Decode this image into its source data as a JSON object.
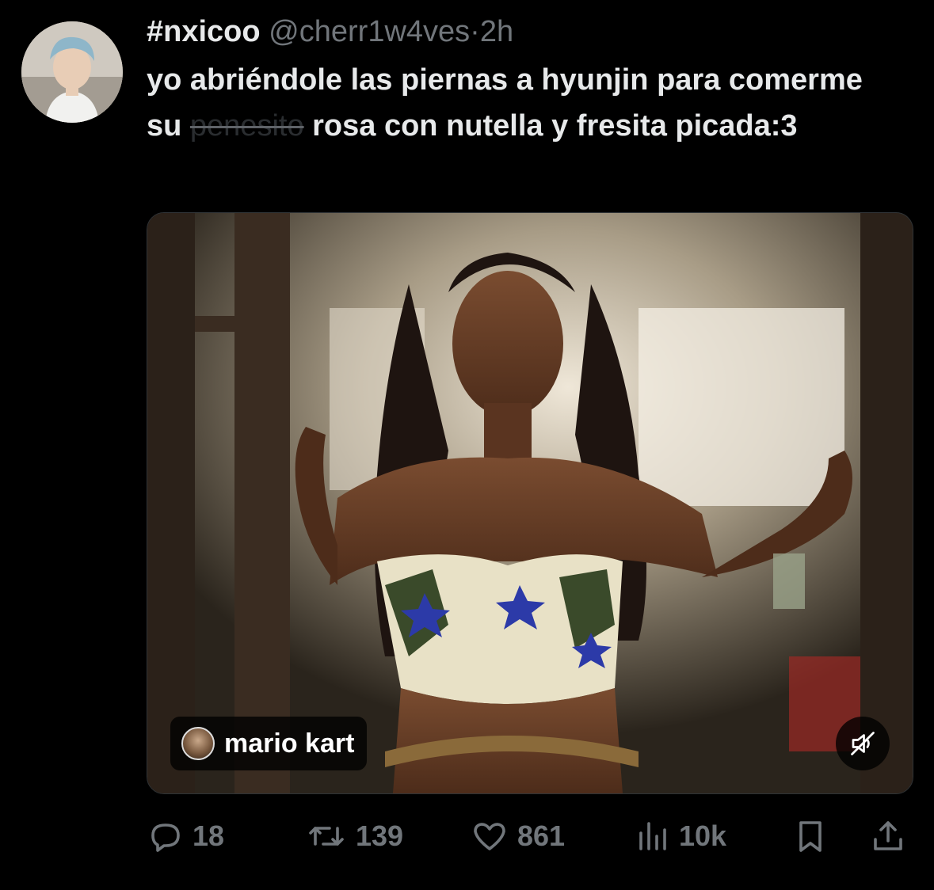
{
  "tweet": {
    "display_name": "#nxicoo",
    "handle": "@cherr1w4ves",
    "separator": "·",
    "time": "2h",
    "text_part1": "yo abriéndole las piernas a hyunjin para comerme su ",
    "text_struck": "penesito",
    "text_part2": " rosa con nutella y fresita picada:3"
  },
  "media": {
    "audio_label": "mario kart",
    "mute_icon": "speaker-muted-icon"
  },
  "actions": {
    "replies": "18",
    "retweets": "139",
    "likes": "861",
    "views": "10k"
  },
  "colors": {
    "background": "#000000",
    "text": "#e7e9ea",
    "secondary": "#71767b"
  }
}
